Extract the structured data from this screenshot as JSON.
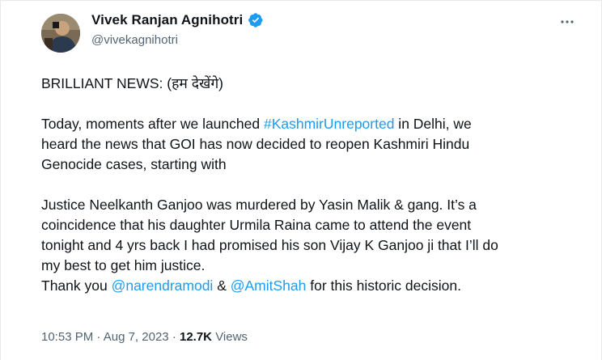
{
  "author": {
    "display_name": "Vivek Ranjan Agnihotri",
    "handle": "@vivekagnihotri",
    "verified": true,
    "verified_color": "#1d9bf0"
  },
  "tweet": {
    "line1": "BRILLIANT NEWS: (हम देखेंगे)",
    "p2_before": "Today, moments after we launched ",
    "p2_hashtag": "#KashmirUnreported",
    "p2_after_line1": " in Delhi, we",
    "p2_line2": "heard the news that GOI has now decided to reopen Kashmiri Hindu",
    "p2_line3": "Genocide cases, starting with",
    "p3_line1": "Justice Neelkanth Ganjoo was murdered by Yasin Malik & gang. It’s a",
    "p3_line2": "coincidence that his daughter Urmila Raina came to attend the event",
    "p3_line3": "tonight and 4 yrs back I had promised his son Vijay K Ganjoo ji that I’ll do",
    "p3_line4": "my best to get him justice.",
    "p4_before": "Thank you ",
    "p4_mention1": "@narendramodi",
    "p4_mid": " & ",
    "p4_mention2": "@AmitShah",
    "p4_after": " for this historic decision."
  },
  "meta": {
    "time": "10:53 PM",
    "separator": "·",
    "date": "Aug 7, 2023",
    "views_count": "12.7K",
    "views_label": "Views"
  },
  "colors": {
    "link": "#1d9bf0",
    "secondary_text": "#536471",
    "primary_text": "#0f1419"
  },
  "icons": {
    "more": "more-horizontal-icon",
    "verified": "verified-badge-icon"
  }
}
